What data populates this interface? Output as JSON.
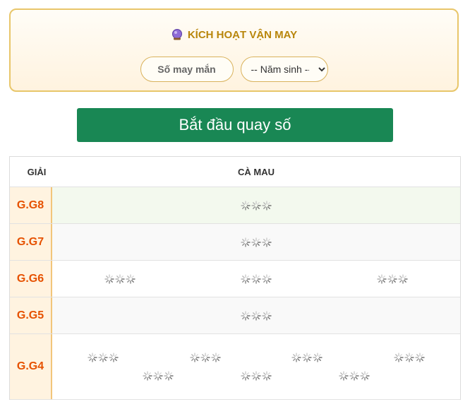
{
  "lucky": {
    "title": "KÍCH HOẠT VẬN MAY",
    "lucky_number_placeholder": "Số may mắn",
    "birth_year_selected": "-- Năm sinh --"
  },
  "spin_button_label": "Bắt đầu quay số",
  "table": {
    "col_prize": "GIẢI",
    "col_province": "CÀ MAU",
    "rows": [
      {
        "prize": "G.G8",
        "slots": 1
      },
      {
        "prize": "G.G7",
        "slots": 1
      },
      {
        "prize": "G.G6",
        "slots": 3
      },
      {
        "prize": "G.G5",
        "slots": 1
      },
      {
        "prize": "G.G4",
        "slots": 7
      }
    ]
  },
  "colors": {
    "accent_gold": "#b8860b",
    "button_green": "#198754",
    "prize_orange": "#e65100"
  },
  "icons": [
    "crystal-ball-icon",
    "loading-spinner-icon"
  ]
}
